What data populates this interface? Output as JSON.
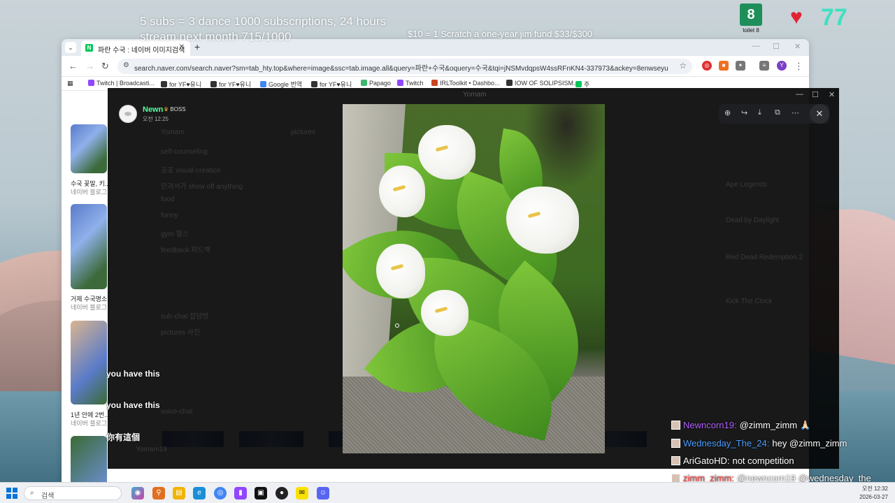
{
  "stream": {
    "goal_text": "5 subs = 3 dance 1000 subscriptions, 24 hours stream next month 715/1000",
    "fund_text": "$10 = 1 Scratch a one-year jim fund $33/$300",
    "sub_badge_number": "8",
    "sub_badge_label": "toilet 8",
    "heart_count": "77"
  },
  "browser": {
    "tab_title": "파란 수국 : 네이버 이미지검색",
    "url": "search.naver.com/search.naver?sm=tab_hty.top&where=image&ssc=tab.image.all&query=파란+수국&oquery=수국&tqi=jNSMvdqpsW4ssRFnKN4-337973&ackey=8enwseyu",
    "profile_initial": "Y",
    "bookmarks": [
      "Twitch | Broadcasti...",
      "for YF♥유니",
      "for YF♥유니",
      "Google 번역",
      "for YF♥유니",
      "Papago",
      "Twitch",
      "IRLToolkit • Dashbo...",
      "IOW OF SOLIPSISM...",
      "주"
    ],
    "results": [
      {
        "title": "수국 꽃말, 키...",
        "source": "네이버 블로그"
      },
      {
        "title": "거제 수국명소...",
        "source": "네이버 블로그"
      },
      {
        "title": "1년 안에 2번...",
        "source": "네이버 블로그"
      }
    ]
  },
  "discord": {
    "window_title": "Yomam",
    "username": "Newn",
    "role_badge": "BOSS",
    "timestamp": "오전 12:25",
    "bg_channels": [
      "Yomam",
      "self-counseling",
      "공포 visual-creation",
      "인과서가 show off anything",
      "food",
      "funny",
      "gym 헬스",
      "feedback 피드백",
      "sub-chat 잡담방",
      "pictures 사진",
      "voice-chat"
    ],
    "bg_right": [
      "Ape Legends",
      "Dead by Daylight",
      "Red Dead Redemption 2",
      "Kick The Clock"
    ],
    "bg_bottom_user": "Yomam19",
    "bg_channel_header": "pictures"
  },
  "subtitles": [
    "you have this",
    "you have this",
    "你有這個"
  ],
  "chat": [
    {
      "name": "Newncorn19:",
      "name_color": "#b05dff",
      "message": "@zimm_zimm 🙏🏻"
    },
    {
      "name": "Wednesday_The_24:",
      "name_color": "#4a9cff",
      "message": "hey @zimm_zimm"
    },
    {
      "name": "AriGatoHD:",
      "name_color": "#ffffff",
      "message": "not competition"
    },
    {
      "name": "zimm_zimm:",
      "name_color": "#ff4a4a",
      "message": "@newncorn19 @wednesday_the"
    }
  ],
  "taskbar": {
    "search_placeholder": "검색",
    "time": "오전 12:32",
    "date": "2026-03-27"
  }
}
